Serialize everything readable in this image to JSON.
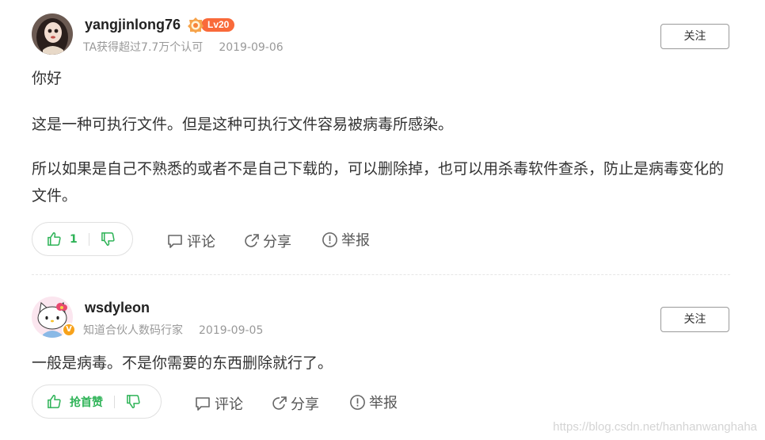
{
  "answers": [
    {
      "username": "yangjinlong76",
      "level": "Lv20",
      "meta": "TA获得超过7.7万个认可",
      "date": "2019-09-06",
      "follow_label": "关注",
      "paragraphs": [
        "你好",
        "这是一种可执行文件。但是这种可执行文件容易被病毒所感染。",
        "所以如果是自己不熟悉的或者不是自己下载的，可以删除掉，也可以用杀毒软件查杀，防止是病毒变化的文件。"
      ],
      "like_count": "1",
      "comment_label": "评论",
      "share_label": "分享",
      "report_label": "举报"
    },
    {
      "username": "wsdyleon",
      "badge": "V",
      "meta": "知道合伙人数码行家",
      "date": "2019-09-05",
      "follow_label": "关注",
      "paragraphs": [
        "一般是病毒。不是你需要的东西删除就行了。"
      ],
      "like_label": "抢首赞",
      "comment_label": "评论",
      "share_label": "分享",
      "report_label": "举报"
    }
  ],
  "watermark": "https://blog.csdn.net/hanhanwanghaha",
  "colors": {
    "like_green": "#2eb357",
    "level_orange": "#f96a3a",
    "v_badge": "#f7a21b",
    "meta_gray": "#999999"
  },
  "icons": [
    "avatar-doll",
    "avatar-hello-kitty",
    "medal-icon",
    "thumb-up-icon",
    "thumb-down-icon",
    "comment-icon",
    "share-icon",
    "report-icon"
  ]
}
